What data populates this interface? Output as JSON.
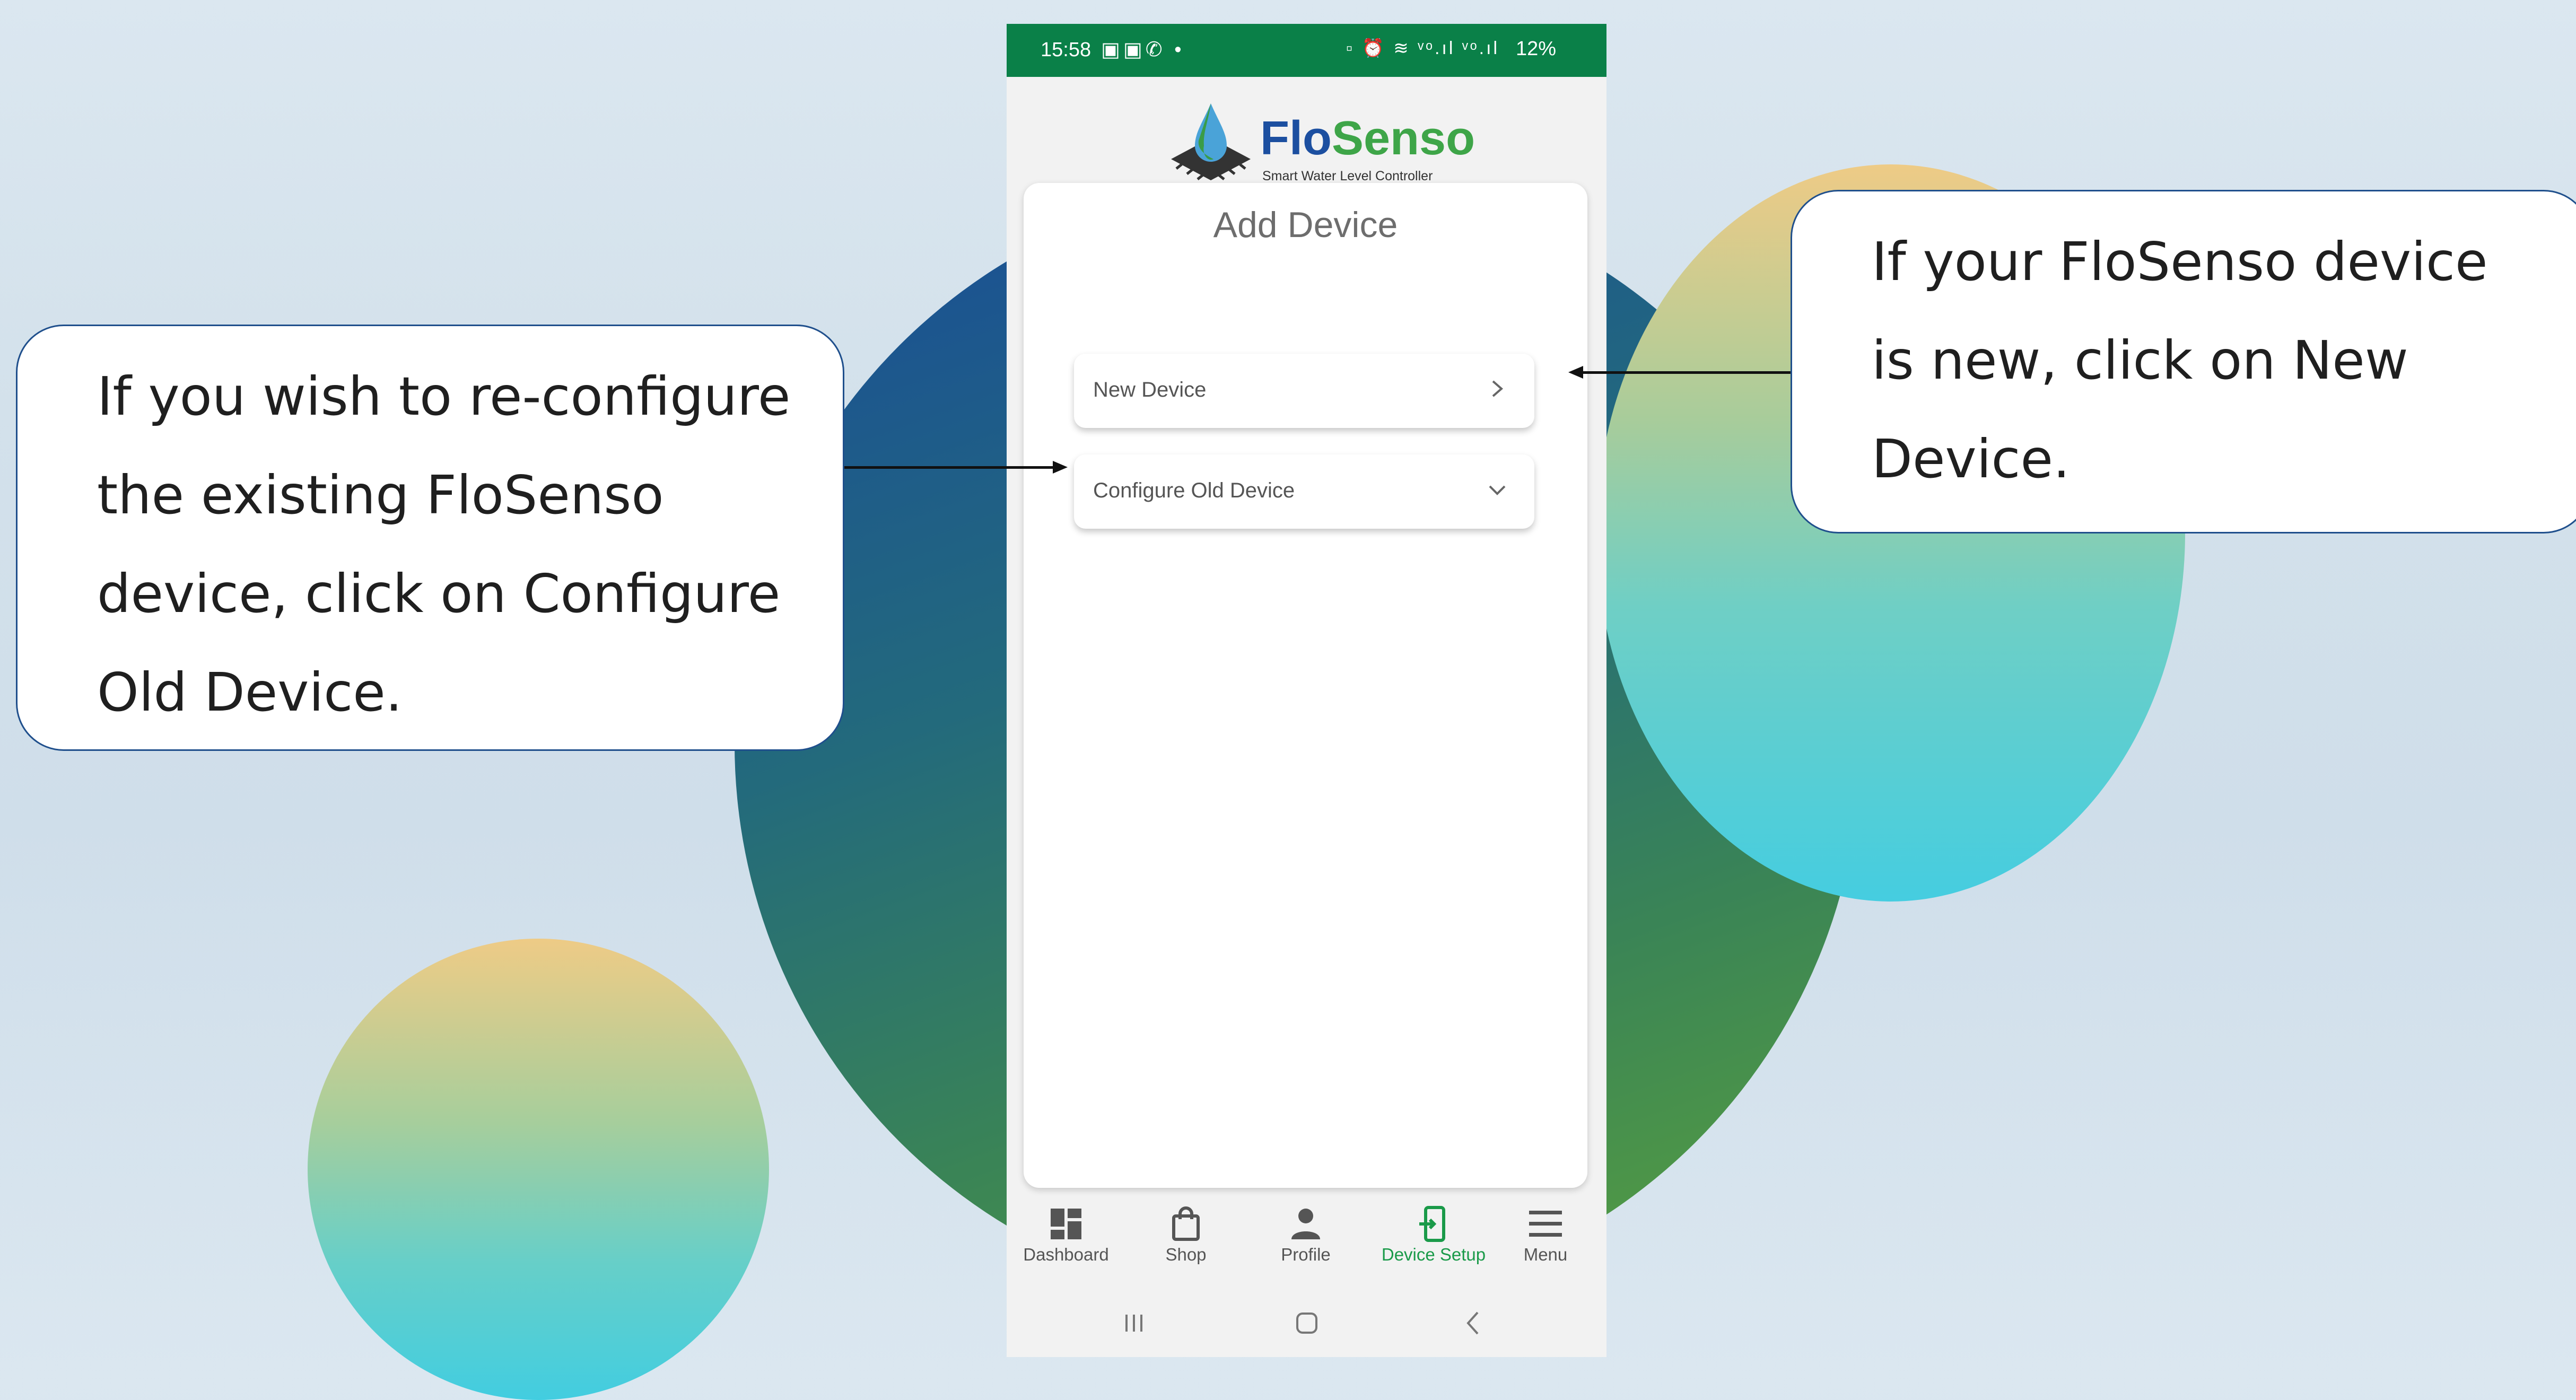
{
  "status_bar": {
    "time": "15:58",
    "left_icons": "▣▣✆ •",
    "right_icons": "▫ ⏰ ≋ ᵛᵒ.ıl ᵛᵒ.ıl",
    "battery": "12%"
  },
  "logo": {
    "brand_part1": "Flo",
    "brand_part2": "Senso",
    "tagline": "Smart Water Level Controller"
  },
  "page": {
    "title": "Add Device"
  },
  "options": [
    {
      "label": "New Device",
      "icon": "chevron-right-icon"
    },
    {
      "label": "Configure Old Device",
      "icon": "chevron-down-icon"
    }
  ],
  "bottom_nav": [
    {
      "label": "Dashboard",
      "icon": "dashboard-icon",
      "active": false
    },
    {
      "label": "Shop",
      "icon": "shopping-bag-icon",
      "active": false
    },
    {
      "label": "Profile",
      "icon": "person-icon",
      "active": false
    },
    {
      "label": "Device Setup",
      "icon": "device-setup-icon",
      "active": true
    },
    {
      "label": "Menu",
      "icon": "hamburger-icon",
      "active": false
    }
  ],
  "callouts": {
    "left_lines": [
      "If you wish to re-configure",
      "the existing FloSenso",
      "device, click on Configure",
      "Old Device."
    ],
    "right_lines": [
      "If your FloSenso device",
      "is new, click on New",
      "Device."
    ]
  },
  "colors": {
    "status_bar": "#0a8048",
    "accent_green": "#1a9a49",
    "brand_blue": "#1c4fa0",
    "callout_border": "#1f4f8c"
  }
}
